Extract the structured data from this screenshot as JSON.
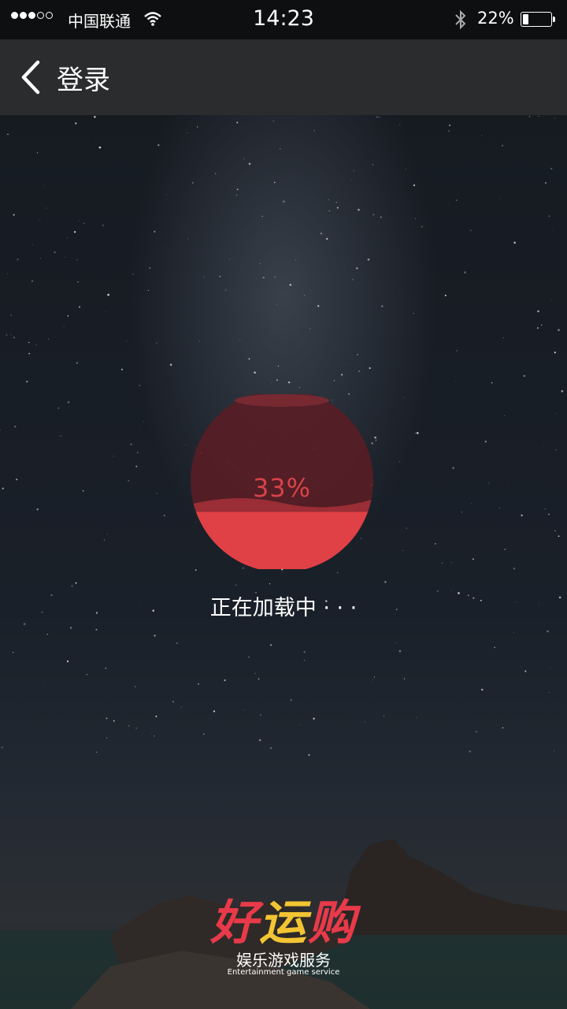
{
  "status_bar": {
    "carrier": "中国联通",
    "signal_bars_filled": 3,
    "signal_bars_total": 5,
    "time": "14:23",
    "battery_percent": "22%",
    "battery_level": 0.22
  },
  "nav": {
    "title": "登录"
  },
  "loader": {
    "percent_label": "33%",
    "fill_level": 0.33,
    "fill_color": "#e04146",
    "empty_color": "#5a1d24"
  },
  "loading_text": "正在加载中 · · ·",
  "brand": {
    "logo_part1": "好",
    "logo_part2": "运",
    "logo_part3": "购",
    "tagline_cn": "娱乐游戏服务",
    "tagline_en": "Entertainment game service",
    "primary_color": "#e83a4a",
    "accent_color": "#f3c533"
  }
}
